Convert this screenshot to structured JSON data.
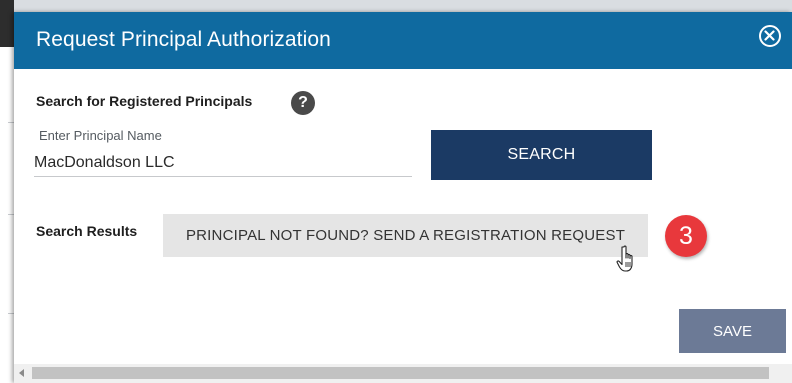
{
  "dialog": {
    "title": "Request Principal Authorization",
    "close_icon": "close-circle-icon"
  },
  "search_section": {
    "label": "Search for Registered Principals",
    "help_icon": "question-circle-icon",
    "help_glyph": "?",
    "field_label": "Enter Principal Name",
    "field_value": "MacDonaldson LLC",
    "search_button": "SEARCH"
  },
  "results_section": {
    "label": "Search Results",
    "register_button": "PRINCIPAL NOT FOUND? SEND A REGISTRATION REQUEST",
    "step_badge": "3"
  },
  "footer": {
    "save_button": "SAVE"
  },
  "colors": {
    "header": "#0f6aa0",
    "search_button": "#1b3a64",
    "save_button": "#6c7a96",
    "badge": "#e8383c",
    "register_button": "#e5e5e5"
  }
}
